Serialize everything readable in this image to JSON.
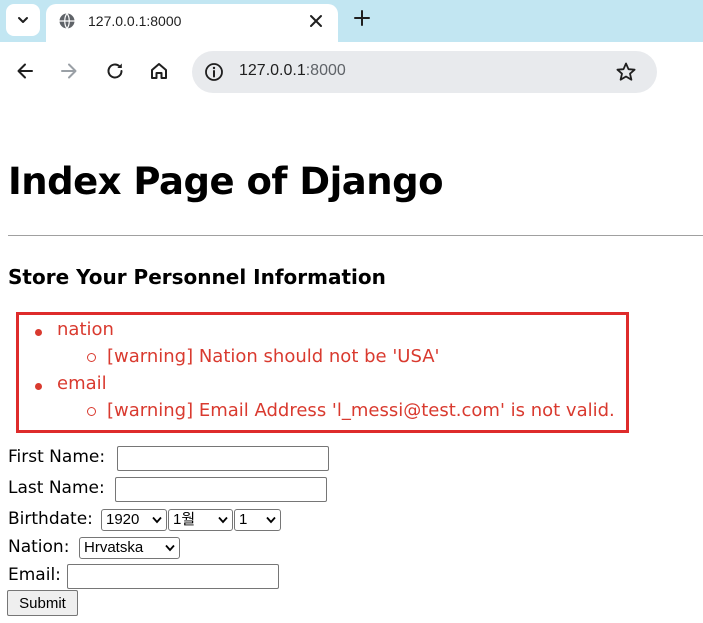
{
  "browser": {
    "tab_title": "127.0.0.1:8000",
    "url_host": "127.0.0.1",
    "url_port": ":8000"
  },
  "page": {
    "title": "Index Page of Django",
    "section_title": "Store Your Personnel Information",
    "errors": [
      {
        "field": "nation",
        "message": "[warning] Nation should not be 'USA'"
      },
      {
        "field": "email",
        "message": "[warning] Email Address 'l_messi@test.com' is not valid."
      }
    ],
    "form": {
      "first_name_label": "First Name:",
      "first_name_value": "",
      "last_name_label": "Last Name:",
      "last_name_value": "",
      "birthdate_label": "Birthdate:",
      "birth_year": "1920",
      "birth_month": "1월",
      "birth_day": "1",
      "nation_label": "Nation:",
      "nation_value": "Hrvatska",
      "email_label": "Email:",
      "email_value": "",
      "submit_label": "Submit"
    }
  },
  "colors": {
    "error": "#d93a2f",
    "error_border": "#de2b2b",
    "tabstrip": "#c2e6f2"
  }
}
